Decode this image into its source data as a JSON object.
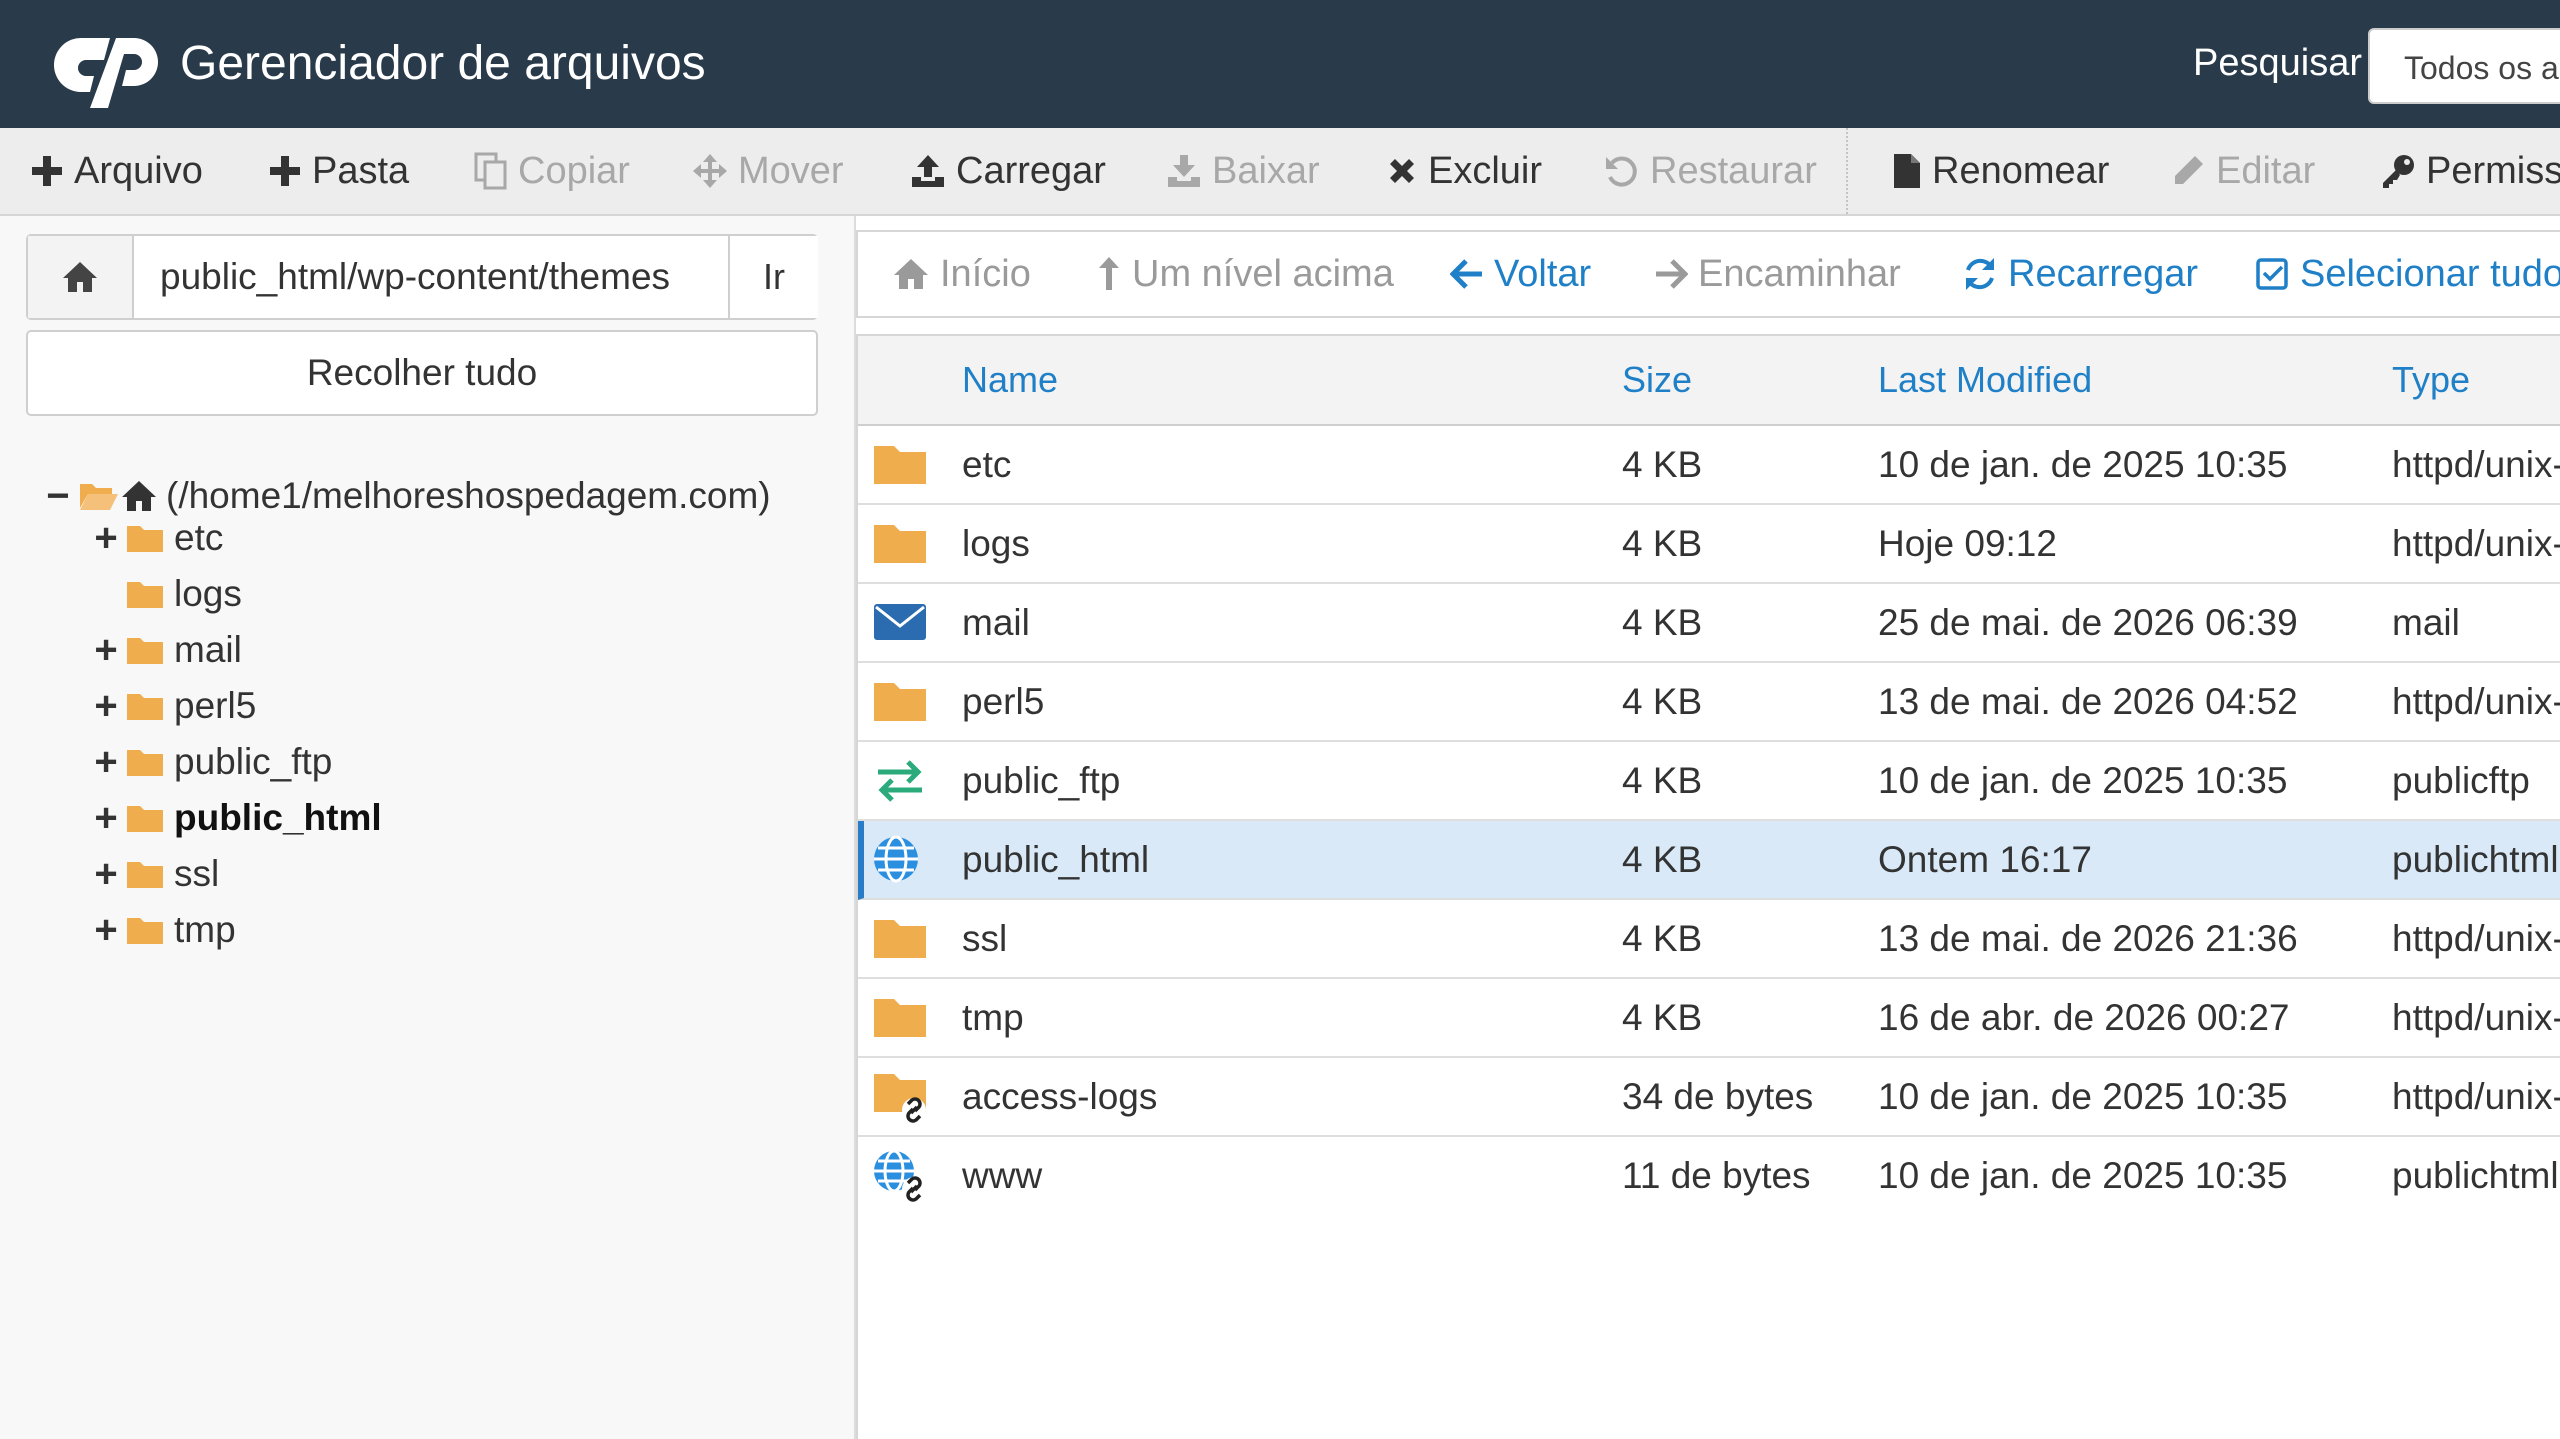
{
  "header": {
    "title": "Gerenciador de arquivos",
    "search_label": "Pesquisar",
    "search_scope": "Todos os ar"
  },
  "toolbar": {
    "items": [
      {
        "label": "Arquivo",
        "icon": "plus-icon",
        "enabled": true
      },
      {
        "label": "Pasta",
        "icon": "plus-icon",
        "enabled": true
      },
      {
        "label": "Copiar",
        "icon": "copy-icon",
        "enabled": false
      },
      {
        "label": "Mover",
        "icon": "move-icon",
        "enabled": false
      },
      {
        "label": "Carregar",
        "icon": "upload-icon",
        "enabled": true
      },
      {
        "label": "Baixar",
        "icon": "download-icon",
        "enabled": false
      },
      {
        "label": "Excluir",
        "icon": "close-icon",
        "enabled": true
      },
      {
        "label": "Restaurar",
        "icon": "undo-icon",
        "enabled": false
      },
      {
        "label": "Renomear",
        "icon": "file-icon",
        "enabled": true
      },
      {
        "label": "Editar",
        "icon": "pencil-icon",
        "enabled": false
      },
      {
        "label": "Permiss",
        "icon": "key-icon",
        "enabled": true
      }
    ]
  },
  "sidebar": {
    "path_value": "public_html/wp-content/themes",
    "go_label": "Ir",
    "collapse_label": "Recolher tudo",
    "tree": [
      {
        "label": "(/home1/melhoreshospedagem.com)",
        "toggle": "−",
        "bold": false
      },
      {
        "label": "etc",
        "toggle": "+",
        "bold": false
      },
      {
        "label": "logs",
        "toggle": "",
        "bold": false
      },
      {
        "label": "mail",
        "toggle": "+",
        "bold": false
      },
      {
        "label": "perl5",
        "toggle": "+",
        "bold": false
      },
      {
        "label": "public_ftp",
        "toggle": "+",
        "bold": false
      },
      {
        "label": "public_html",
        "toggle": "+",
        "bold": true
      },
      {
        "label": "ssl",
        "toggle": "+",
        "bold": false
      },
      {
        "label": "tmp",
        "toggle": "+",
        "bold": false
      }
    ]
  },
  "nav": {
    "items": [
      {
        "label": "Início",
        "icon": "home-icon",
        "enabled": false
      },
      {
        "label": "Um nível acima",
        "icon": "level-up-icon",
        "enabled": false
      },
      {
        "label": "Voltar",
        "icon": "arrow-left-icon",
        "enabled": true
      },
      {
        "label": "Encaminhar",
        "icon": "arrow-right-icon",
        "enabled": false
      },
      {
        "label": "Recarregar",
        "icon": "refresh-icon",
        "enabled": true
      },
      {
        "label": "Selecionar tudo",
        "icon": "checkbox-icon",
        "enabled": true
      }
    ]
  },
  "files": {
    "columns": [
      "Name",
      "Size",
      "Last Modified",
      "Type"
    ],
    "rows": [
      {
        "icon": "folder-icon",
        "name": "etc",
        "size": "4 KB",
        "modified": "10 de jan. de 2025 10:35",
        "type": "httpd/unix-",
        "selected": false
      },
      {
        "icon": "folder-icon",
        "name": "logs",
        "size": "4 KB",
        "modified": "Hoje 09:12",
        "type": "httpd/unix-",
        "selected": false
      },
      {
        "icon": "mail-icon",
        "name": "mail",
        "size": "4 KB",
        "modified": "25 de mai. de 2026 06:39",
        "type": "mail",
        "selected": false
      },
      {
        "icon": "folder-icon",
        "name": "perl5",
        "size": "4 KB",
        "modified": "13 de mai. de 2026 04:52",
        "type": "httpd/unix-",
        "selected": false
      },
      {
        "icon": "transfer-icon",
        "name": "public_ftp",
        "size": "4 KB",
        "modified": "10 de jan. de 2025 10:35",
        "type": "publicftp",
        "selected": false
      },
      {
        "icon": "globe-icon",
        "name": "public_html",
        "size": "4 KB",
        "modified": "Ontem 16:17",
        "type": "publichtml",
        "selected": true
      },
      {
        "icon": "folder-icon",
        "name": "ssl",
        "size": "4 KB",
        "modified": "13 de mai. de 2026 21:36",
        "type": "httpd/unix-",
        "selected": false
      },
      {
        "icon": "folder-icon",
        "name": "tmp",
        "size": "4 KB",
        "modified": "16 de abr. de 2026 00:27",
        "type": "httpd/unix-",
        "selected": false
      },
      {
        "icon": "folder-link-icon",
        "name": "access-logs",
        "size": "34 de bytes",
        "modified": "10 de jan. de 2025 10:35",
        "type": "httpd/unix-",
        "selected": false
      },
      {
        "icon": "globe-link-icon",
        "name": "www",
        "size": "11 de bytes",
        "modified": "10 de jan. de 2025 10:35",
        "type": "publichtml",
        "selected": false
      }
    ]
  },
  "colors": {
    "header_bg": "#293a4a",
    "link_blue": "#1f7fc7",
    "folder": "#f0ad4e",
    "selected_row": "#d9e9f7"
  }
}
